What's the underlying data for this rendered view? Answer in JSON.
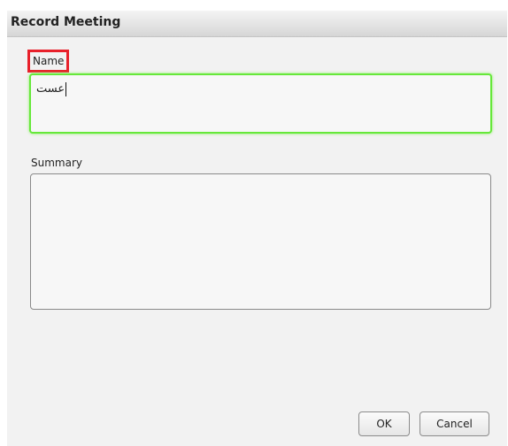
{
  "dialog": {
    "title": "Record Meeting"
  },
  "name_field": {
    "label": "Name",
    "value": "عست"
  },
  "summary_field": {
    "label": "Summary",
    "value": ""
  },
  "buttons": {
    "ok_label": "OK",
    "cancel_label": "Cancel"
  },
  "colors": {
    "focus_border": "#66e83a",
    "highlight_box": "#e8202a",
    "dialog_background": "#f2f2f2"
  }
}
